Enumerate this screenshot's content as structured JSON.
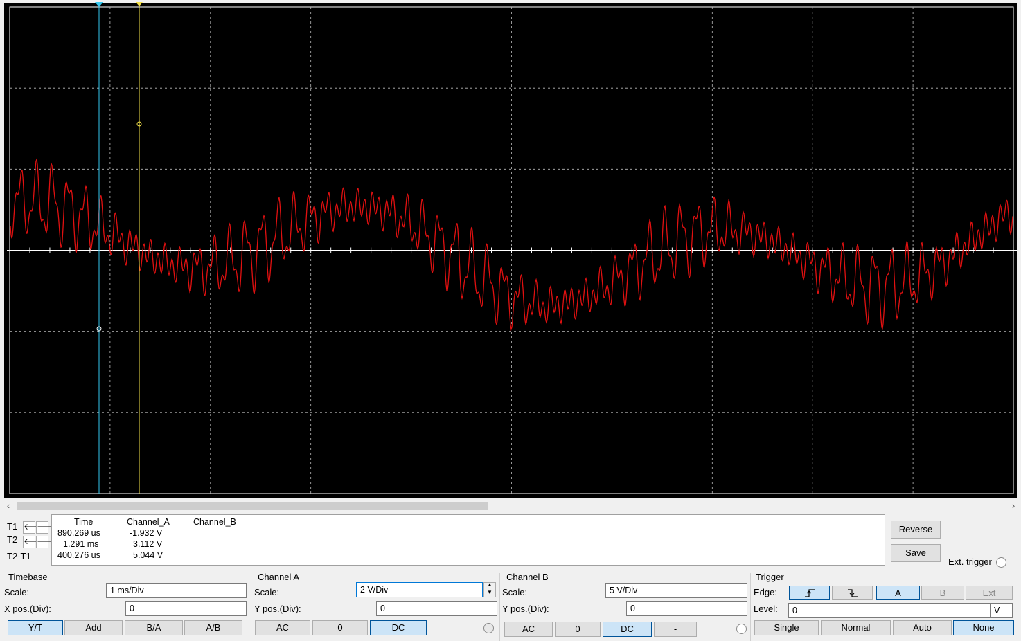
{
  "scope": {
    "trace_color": "#e01010",
    "cursor_t1_color": "#35c8f0",
    "cursor_t2_color": "#f5e24a"
  },
  "readout": {
    "rows": [
      {
        "label": "T1",
        "time": "890.269 us",
        "channel_a": "-1.932 V",
        "channel_b": ""
      },
      {
        "label": "T2",
        "time": "1.291 ms",
        "channel_a": "3.112 V",
        "channel_b": ""
      },
      {
        "label": "T2-T1",
        "time": "400.276 us",
        "channel_a": "5.044 V",
        "channel_b": ""
      }
    ],
    "headers": {
      "time": "Time",
      "channel_a": "Channel_A",
      "channel_b": "Channel_B"
    }
  },
  "side": {
    "reverse": "Reverse",
    "save": "Save",
    "ext_trigger": "Ext. trigger"
  },
  "timebase": {
    "title": "Timebase",
    "scale_label": "Scale:",
    "scale": "1 ms/Div",
    "xpos_label": "X pos.(Div):",
    "xpos": "0",
    "modes": [
      "Y/T",
      "Add",
      "B/A",
      "A/B"
    ],
    "selected_mode": "Y/T"
  },
  "channel_a": {
    "title": "Channel A",
    "scale_label": "Scale:",
    "scale": "2  V/Div",
    "ypos_label": "Y pos.(Div):",
    "ypos": "0",
    "coupling": [
      "AC",
      "0",
      "DC"
    ],
    "selected": "DC"
  },
  "channel_b": {
    "title": "Channel B",
    "scale_label": "Scale:",
    "scale": "5  V/Div",
    "ypos_label": "Y pos.(Div):",
    "ypos": "0",
    "coupling": [
      "AC",
      "0",
      "DC",
      "-"
    ],
    "selected": "DC"
  },
  "trigger": {
    "title": "Trigger",
    "edge_label": "Edge:",
    "level_label": "Level:",
    "level": "0",
    "level_unit": "V",
    "edge_rising": "rising-edge-icon",
    "edge_falling": "falling-edge-icon",
    "sources": [
      "A",
      "B",
      "Ext"
    ],
    "selected_source": "A",
    "modes": [
      "Single",
      "Normal",
      "Auto",
      "None"
    ],
    "selected_mode": "None"
  }
}
